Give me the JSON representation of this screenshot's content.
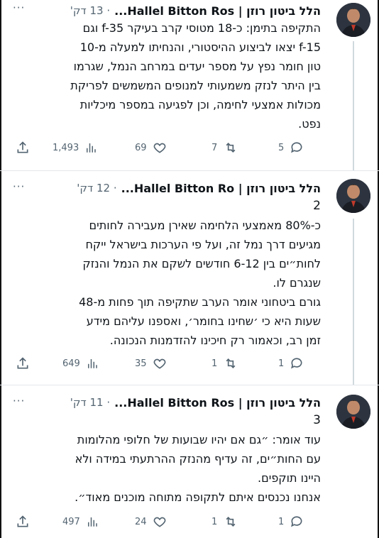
{
  "tweets": [
    {
      "author": "הלל ביטון רוזן | Hallel Bitton Ros...",
      "time": "13 דק'",
      "number": "",
      "lines": [
        "התקיפה בתימן: כ-18 מטוסי קרב בעיקר f-35 וגם",
        "f-15 יצאו לביצוע ההיסטורי, והנחיתו למעלה מ-10",
        "טון חומר נפץ על מספר יעדים במרחב הנמל, שגרמו",
        "בין היתר לנזק משמעותי למנופים המשמשים לפריקת",
        "מכולות אמצעי לחימה, וכן לפגיעה במספר מיכליות",
        "נפט."
      ],
      "replies": "5",
      "retweets": "7",
      "likes": "69",
      "views": "1,493"
    },
    {
      "author": "הלל ביטון רוזן | Hallel Bitton Ro...",
      "time": "12 דק'",
      "number": "2",
      "lines": [
        "כ-80% מאמצעי הלחימה שאירן מעבירה לחותים",
        "מגיעים דרך נמל זה, ועל פי הערכות בישראל ייקח",
        "לחות״ים בין 6-12 חודשים לשקם את הנמל והנזק",
        "שנגרם לו.",
        "גורם ביטחוני אומר הערב שתקיפה תוך פחות מ-48",
        "שעות היא כי ׳שחינו בחומר׳, ואספנו עליהם מידע",
        "זמן רב, וכאמור רק חיכינו להזדמנות הנכונה."
      ],
      "replies": "1",
      "retweets": "1",
      "likes": "35",
      "views": "649"
    },
    {
      "author": "הלל ביטון רוזן | Hallel Bitton Ros...",
      "time": "11 דק'",
      "number": "3",
      "lines": [
        "עוד אומר: ״גם אם יהיו שבועות של חלופי מהלומות",
        "עם החות״ים, זה עדיף מהנזק ההרתעתי במידה ולא",
        "היינו תוקפים.",
        "אנחנו נכנסים איתם לתקופה מתוחה מוכנים מאוד״."
      ],
      "replies": "1",
      "retweets": "1",
      "likes": "24",
      "views": "497"
    }
  ],
  "icons": {
    "reply": "reply-icon",
    "retweet": "retweet-icon",
    "like": "heart-icon",
    "views": "views-icon",
    "share": "share-icon",
    "more": "more-icon"
  },
  "colors": {
    "text": "#0f1419",
    "muted": "#536471",
    "divider": "#e4e7ea"
  }
}
